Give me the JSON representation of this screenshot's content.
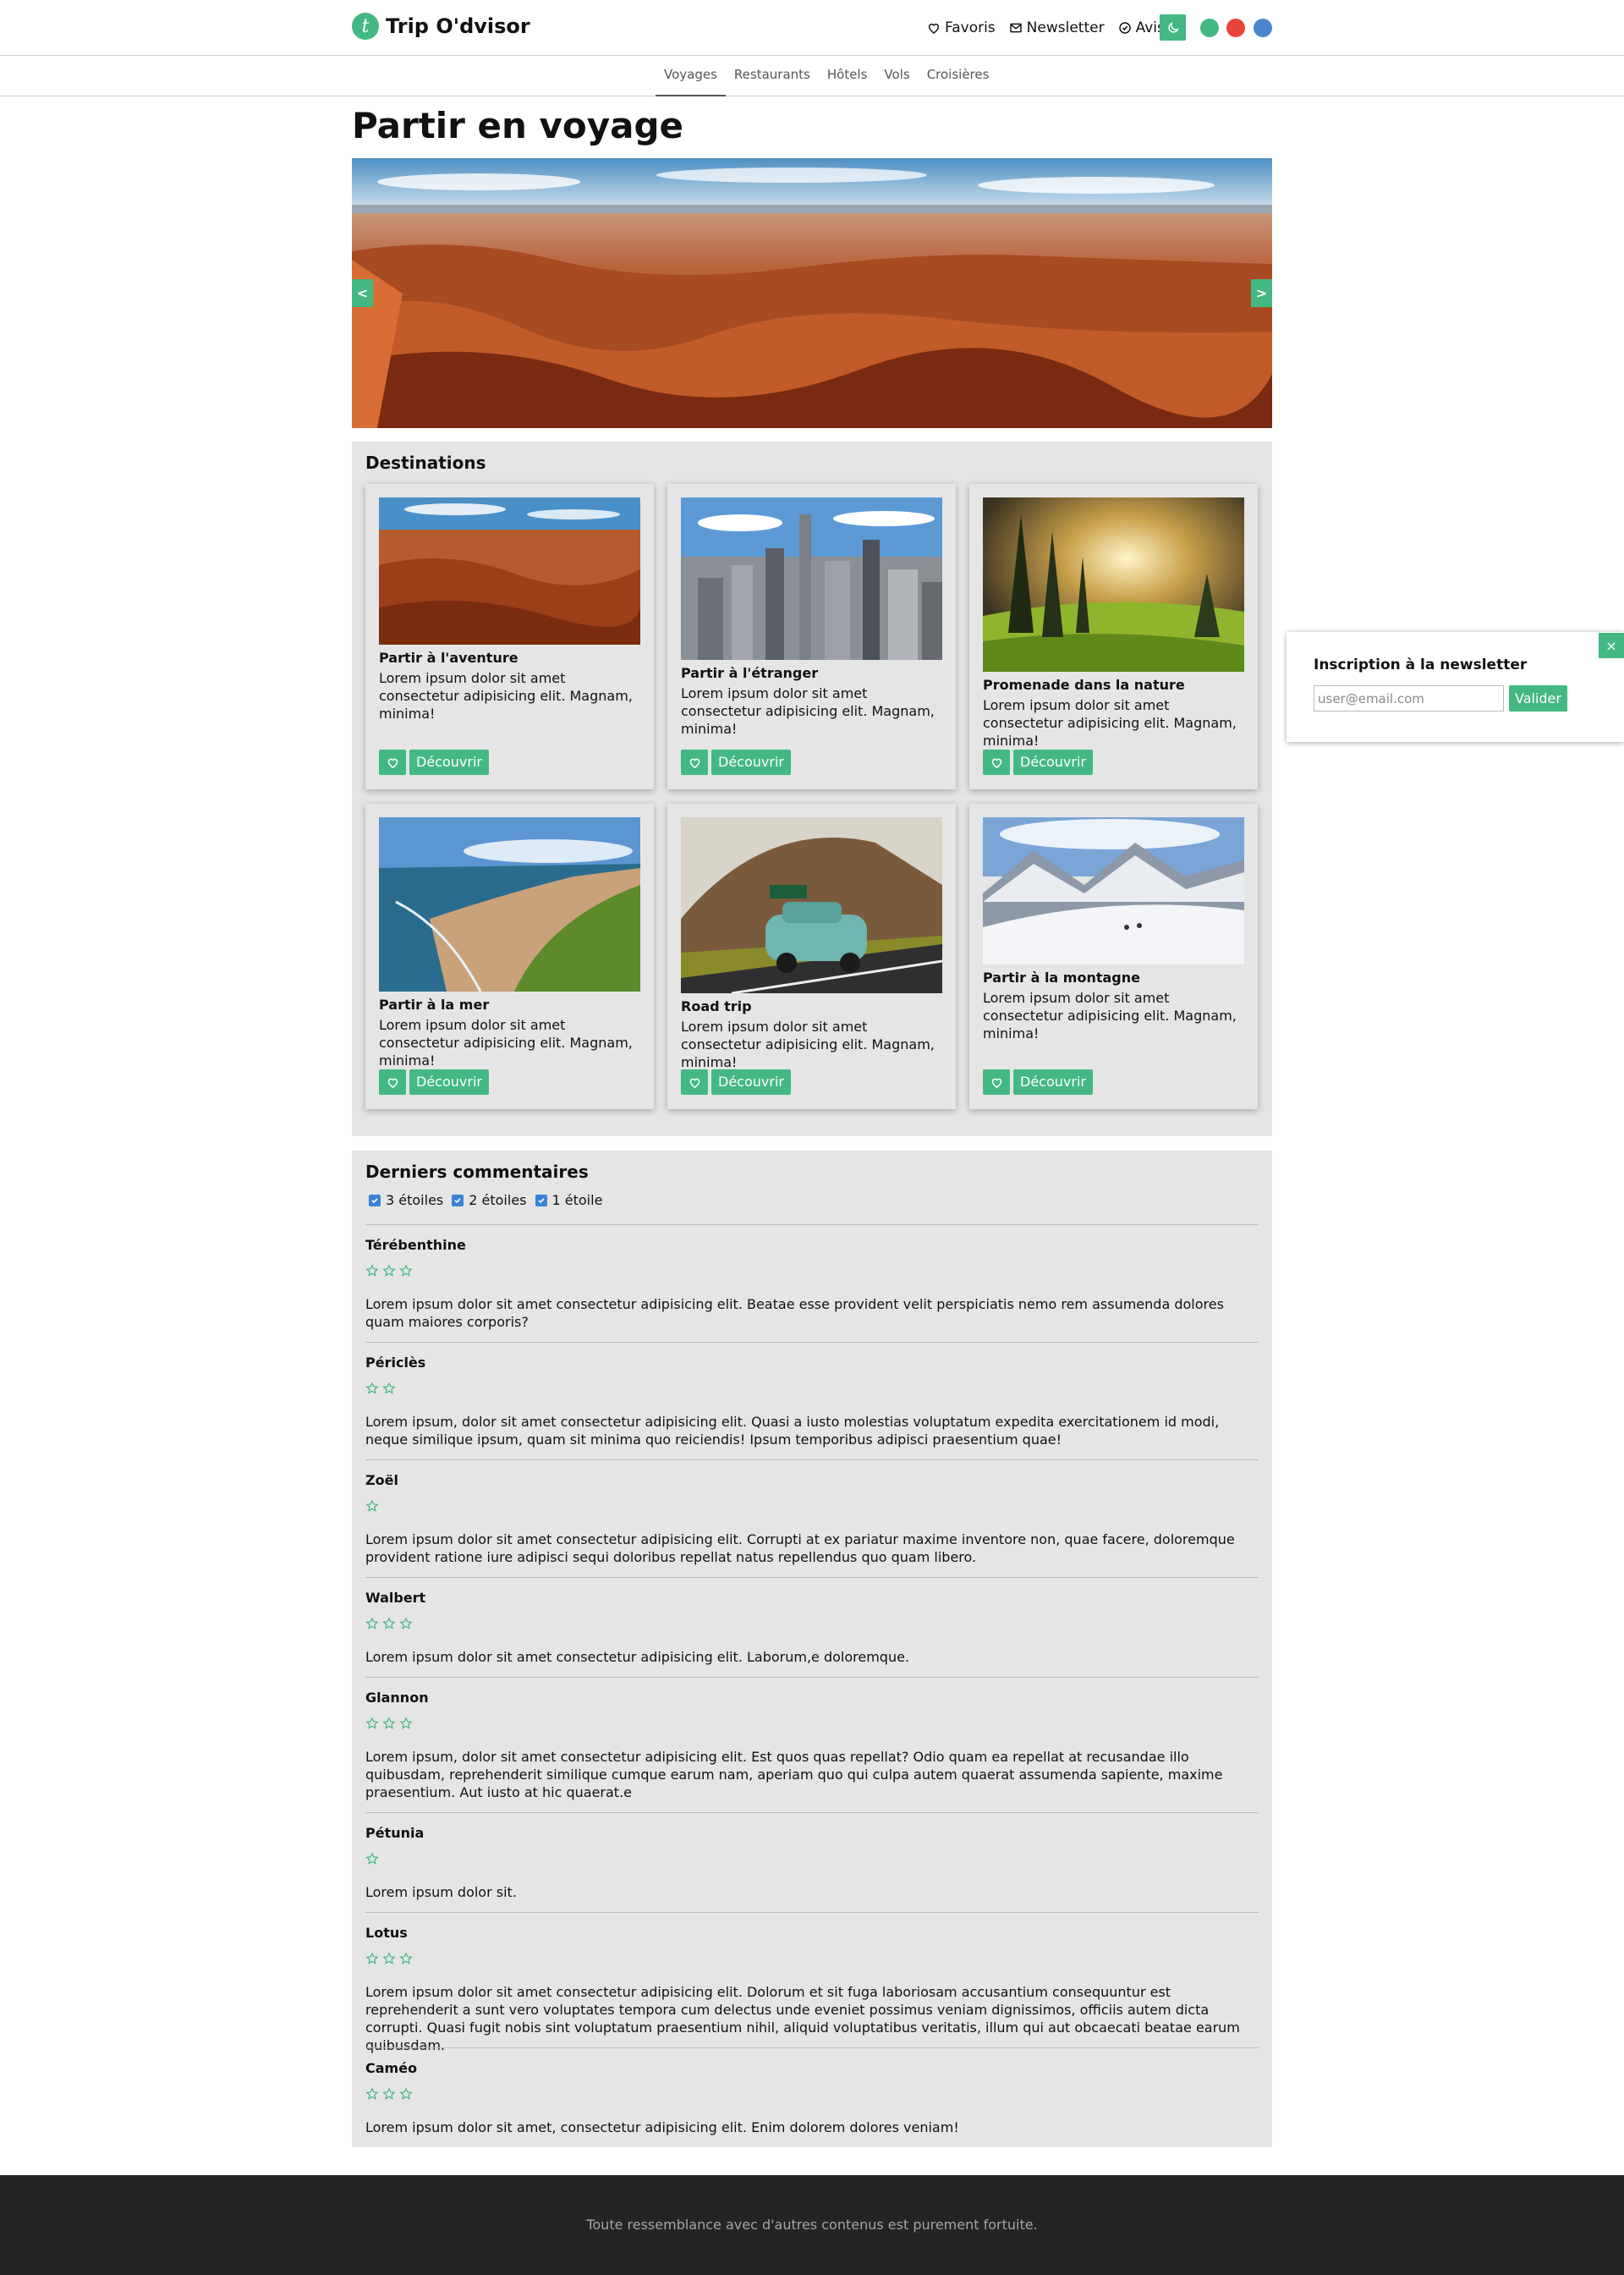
{
  "header": {
    "logo_letter": "t",
    "brand": "Trip O'dvisor",
    "links": [
      {
        "label": "Favoris",
        "icon": "heart-icon"
      },
      {
        "label": "Newsletter",
        "icon": "mail-icon"
      },
      {
        "label": "Avis",
        "icon": "check-circle-icon"
      }
    ],
    "theme_icon": "moon-icon",
    "theme_colors": [
      "#43b883",
      "#e8443a",
      "#4a86cf"
    ]
  },
  "nav": {
    "tabs": [
      "Voyages",
      "Restaurants",
      "Hôtels",
      "Vols",
      "Croisières"
    ],
    "active": "Voyages"
  },
  "page_title": "Partir en voyage",
  "hero": {
    "prev": "<",
    "next": ">"
  },
  "destinations": {
    "title": "Destinations",
    "button_label": "Découvrir",
    "cards": [
      {
        "title": "Partir à l'aventure",
        "text": "Lorem ipsum dolor sit amet consectetur adipisicing elit. Magnam, minima!",
        "image": "canyon"
      },
      {
        "title": "Partir à l'étranger",
        "text": "Lorem ipsum dolor sit amet consectetur adipisicing elit. Magnam, minima!",
        "image": "city"
      },
      {
        "title": "Promenade dans la nature",
        "text": "Lorem ipsum dolor sit amet consectetur adipisicing elit. Magnam, minima!",
        "image": "forest"
      },
      {
        "title": "Partir à la mer",
        "text": "Lorem ipsum dolor sit amet consectetur adipisicing elit. Magnam, minima!",
        "image": "sea"
      },
      {
        "title": "Road trip",
        "text": "Lorem ipsum dolor sit amet consectetur adipisicing elit. Magnam, minima!",
        "image": "car"
      },
      {
        "title": "Partir à la montagne",
        "text": "Lorem ipsum dolor sit amet consectetur adipisicing elit. Magnam, minima!",
        "image": "mountain"
      }
    ]
  },
  "newsletter": {
    "title": "Inscription à la newsletter",
    "placeholder": "user@email.com",
    "submit": "Valider",
    "close": "×"
  },
  "comments": {
    "title": "Derniers commentaires",
    "filters": [
      {
        "label": "3 étoiles",
        "checked": true
      },
      {
        "label": "2 étoiles",
        "checked": true
      },
      {
        "label": "1 étoile",
        "checked": true
      }
    ],
    "items": [
      {
        "author": "Térébenthine",
        "stars": 3,
        "text": "Lorem ipsum dolor sit amet consectetur adipisicing elit. Beatae esse provident velit perspiciatis nemo rem assumenda dolores quam maiores corporis?"
      },
      {
        "author": "Périclès",
        "stars": 2,
        "text": "Lorem ipsum, dolor sit amet consectetur adipisicing elit. Quasi a iusto molestias voluptatum expedita exercitationem id modi, neque similique ipsum, quam sit minima quo reiciendis! Ipsum temporibus adipisci praesentium quae!"
      },
      {
        "author": "Zoël",
        "stars": 1,
        "text": "Lorem ipsum dolor sit amet consectetur adipisicing elit. Corrupti at ex pariatur maxime inventore non, quae facere, doloremque provident ratione iure adipisci sequi doloribus repellat natus repellendus quo quam libero."
      },
      {
        "author": "Walbert",
        "stars": 3,
        "text": "Lorem ipsum dolor sit amet consectetur adipisicing elit. Laborum,e doloremque."
      },
      {
        "author": "Glannon",
        "stars": 3,
        "text": "Lorem ipsum, dolor sit amet consectetur adipisicing elit. Est quos quas repellat? Odio quam ea repellat at recusandae illo quibusdam, reprehenderit similique cumque earum nam, aperiam quo qui culpa autem quaerat assumenda sapiente, maxime praesentium. Aut iusto at hic quaerat.e"
      },
      {
        "author": "Pétunia",
        "stars": 1,
        "text": "Lorem ipsum dolor sit."
      },
      {
        "author": "Lotus",
        "stars": 3,
        "text": "Lorem ipsum dolor sit amet consectetur adipisicing elit. Dolorum et sit fuga laboriosam accusantium consequuntur est reprehenderit a sunt vero voluptates tempora cum delectus unde eveniet possimus veniam dignissimos, officiis autem dicta corrupti. Quasi fugit nobis sint voluptatum praesentium nihil, aliquid voluptatibus veritatis, illum qui aut obcaecati beatae earum quibusdam."
      },
      {
        "author": "Caméo",
        "stars": 3,
        "text": "Lorem ipsum dolor sit amet, consectetur adipisicing elit. Enim dolorem dolores veniam!"
      }
    ]
  },
  "footer": {
    "text": "Toute ressemblance avec d'autres contenus est purement fortuite."
  },
  "colors": {
    "accent": "#43b883",
    "panel": "#e5e5e5",
    "footer": "#242424"
  }
}
